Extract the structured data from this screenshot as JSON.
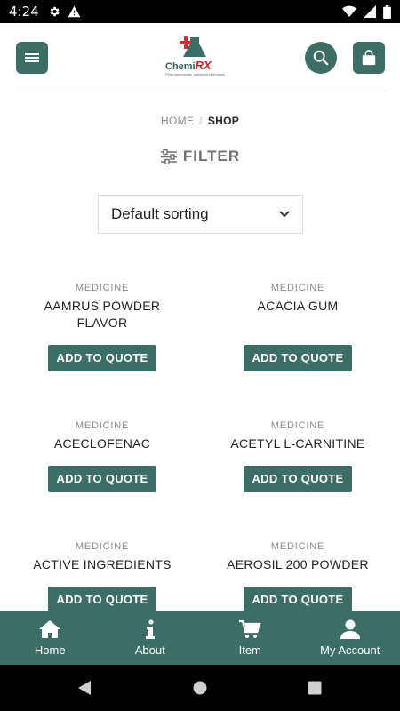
{
  "status_bar": {
    "time": "4:24",
    "icons": [
      "gear-icon",
      "warning-icon",
      "wifi-icon",
      "signal-icon",
      "battery-icon"
    ]
  },
  "header": {
    "logo_text_main": "Chemi",
    "logo_text_rx": "RX",
    "logo_tagline": "Pharmaceuticals, industrial chemicals",
    "icons": [
      "menu-icon",
      "search-icon",
      "shopping-bag-icon"
    ]
  },
  "breadcrumb": {
    "home": "HOME",
    "separator": "/",
    "current": "SHOP"
  },
  "filter": {
    "label": "FILTER",
    "icon": "sliders-icon"
  },
  "sorting": {
    "selected": "Default sorting"
  },
  "products": [
    {
      "category": "MEDICINE",
      "name": "AAMRUS POWDER FLAVOR",
      "button": "ADD TO QUOTE"
    },
    {
      "category": "MEDICINE",
      "name": "ACACIA GUM",
      "button": "ADD TO QUOTE"
    },
    {
      "category": "MEDICINE",
      "name": "ACECLOFENAC",
      "button": "ADD TO QUOTE"
    },
    {
      "category": "MEDICINE",
      "name": "ACETYL L-CARNITINE",
      "button": "ADD TO QUOTE"
    },
    {
      "category": "MEDICINE",
      "name": "ACTIVE INGREDIENTS",
      "button": "ADD TO QUOTE"
    },
    {
      "category": "MEDICINE",
      "name": "AEROSIL 200 POWDER",
      "button": "ADD TO QUOTE"
    }
  ],
  "bottom_nav": [
    {
      "label": "Home",
      "icon": "home-icon"
    },
    {
      "label": "About",
      "icon": "info-icon"
    },
    {
      "label": "Item",
      "icon": "cart-icon"
    },
    {
      "label": "My Account",
      "icon": "user-icon"
    }
  ],
  "colors": {
    "accent": "#3d6e66",
    "logo_red": "#c62828"
  }
}
